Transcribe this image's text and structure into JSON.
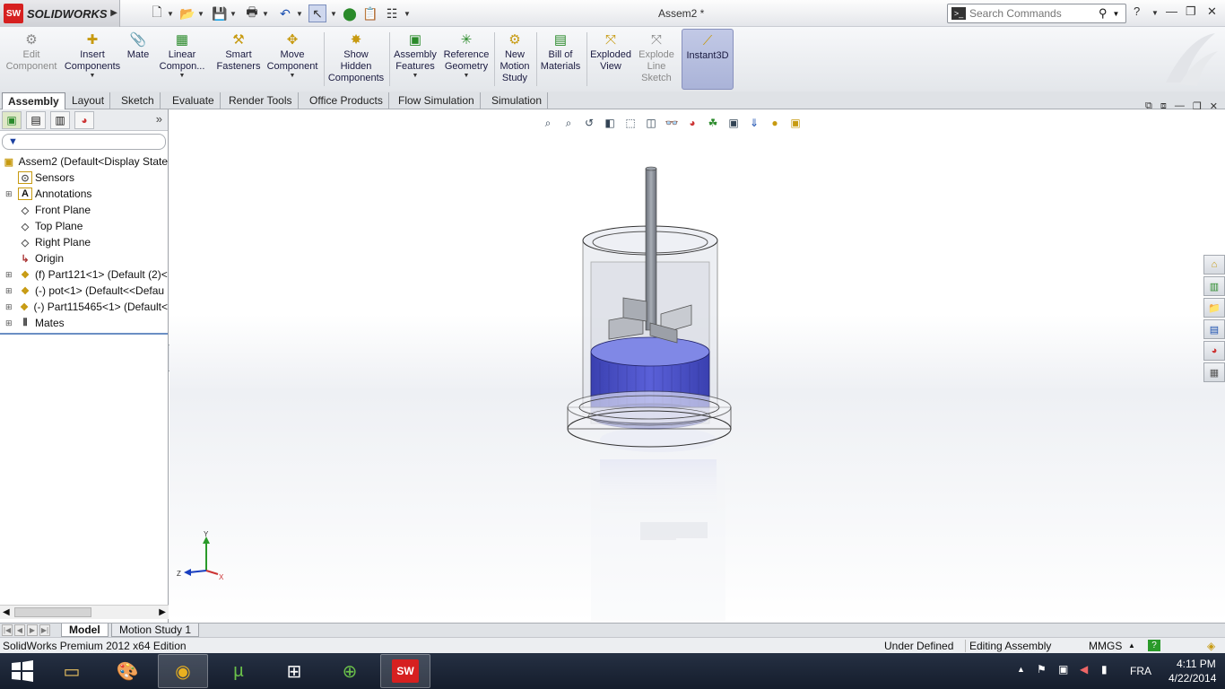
{
  "app": {
    "name": "SOLIDWORKS",
    "document_title": "Assem2 *"
  },
  "search": {
    "placeholder": "Search Commands"
  },
  "ribbon": {
    "buttons": [
      {
        "label": "Edit\nComponent",
        "icon": "edit-component-icon",
        "enabled": false
      },
      {
        "label": "Insert\nComponents",
        "icon": "insert-components-icon",
        "enabled": true
      },
      {
        "label": "Mate",
        "icon": "mate-icon",
        "enabled": true
      },
      {
        "label": "Linear\nCompon...",
        "icon": "linear-pattern-icon",
        "enabled": true
      },
      {
        "label": "Smart\nFasteners",
        "icon": "smart-fasteners-icon",
        "enabled": true
      },
      {
        "label": "Move\nComponent",
        "icon": "move-component-icon",
        "enabled": true
      },
      {
        "label": "Show\nHidden\nComponents",
        "icon": "show-hidden-icon",
        "enabled": true
      },
      {
        "label": "Assembly\nFeatures",
        "icon": "assembly-features-icon",
        "enabled": true
      },
      {
        "label": "Reference\nGeometry",
        "icon": "reference-geometry-icon",
        "enabled": true
      },
      {
        "label": "New\nMotion\nStudy",
        "icon": "motion-study-icon",
        "enabled": true
      },
      {
        "label": "Bill of\nMaterials",
        "icon": "bill-of-materials-icon",
        "enabled": true
      },
      {
        "label": "Exploded\nView",
        "icon": "exploded-view-icon",
        "enabled": true
      },
      {
        "label": "Explode\nLine\nSketch",
        "icon": "explode-line-icon",
        "enabled": false
      },
      {
        "label": "Instant3D",
        "icon": "instant3d-icon",
        "enabled": true
      }
    ]
  },
  "tabs": [
    "Assembly",
    "Layout",
    "Sketch",
    "Evaluate",
    "Render Tools",
    "Office Products",
    "Flow Simulation",
    "Simulation"
  ],
  "active_tab": "Assembly",
  "tree": {
    "root": "Assem2  (Default<Display State",
    "items": [
      {
        "label": "Sensors",
        "icon": "sensors-icon",
        "expandable": false
      },
      {
        "label": "Annotations",
        "icon": "annotations-icon",
        "expandable": true
      },
      {
        "label": "Front Plane",
        "icon": "plane-icon",
        "expandable": false
      },
      {
        "label": "Top Plane",
        "icon": "plane-icon",
        "expandable": false
      },
      {
        "label": "Right Plane",
        "icon": "plane-icon",
        "expandable": false
      },
      {
        "label": "Origin",
        "icon": "origin-icon",
        "expandable": false
      },
      {
        "label": "(f) Part121<1> (Default (2)<",
        "icon": "part-icon",
        "expandable": true
      },
      {
        "label": "(-) pot<1> (Default<<Defau",
        "icon": "part-icon",
        "expandable": true
      },
      {
        "label": "(-) Part115465<1> (Default<",
        "icon": "part-icon",
        "expandable": true
      },
      {
        "label": "Mates",
        "icon": "mates-icon",
        "expandable": true
      }
    ]
  },
  "triad": {
    "x": "X",
    "y": "Y",
    "z": "Z"
  },
  "bottom_tabs": [
    "Model",
    "Motion Study 1"
  ],
  "status": {
    "edition": "SolidWorks Premium 2012 x64 Edition",
    "definition": "Under Defined",
    "mode": "Editing Assembly",
    "units": "MMGS"
  },
  "taskbar": {
    "apps": [
      "file-explorer-icon",
      "paint-icon",
      "chrome-icon",
      "utorrent-icon",
      "apps-icon",
      "network-icon",
      "solidworks-icon"
    ],
    "language": "FRA",
    "time": "4:11 PM",
    "date": "4/22/2014"
  },
  "colors": {
    "accent": "#d62020",
    "liquid": "#4b52c4",
    "ribbon_active": "#aab3d8"
  }
}
